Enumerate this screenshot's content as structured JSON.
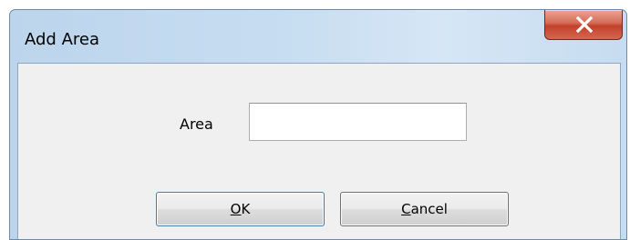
{
  "window": {
    "title": "Add Area"
  },
  "form": {
    "area_label": "Area",
    "area_value": ""
  },
  "buttons": {
    "ok_mnemonic": "O",
    "ok_rest": "K",
    "cancel_mnemonic": "C",
    "cancel_rest": "ancel"
  },
  "icons": {
    "close": "close-icon"
  },
  "colors": {
    "close_button": "#c8503a",
    "titlebar": "#c7ddf1",
    "client_background": "#f0f0f0"
  }
}
